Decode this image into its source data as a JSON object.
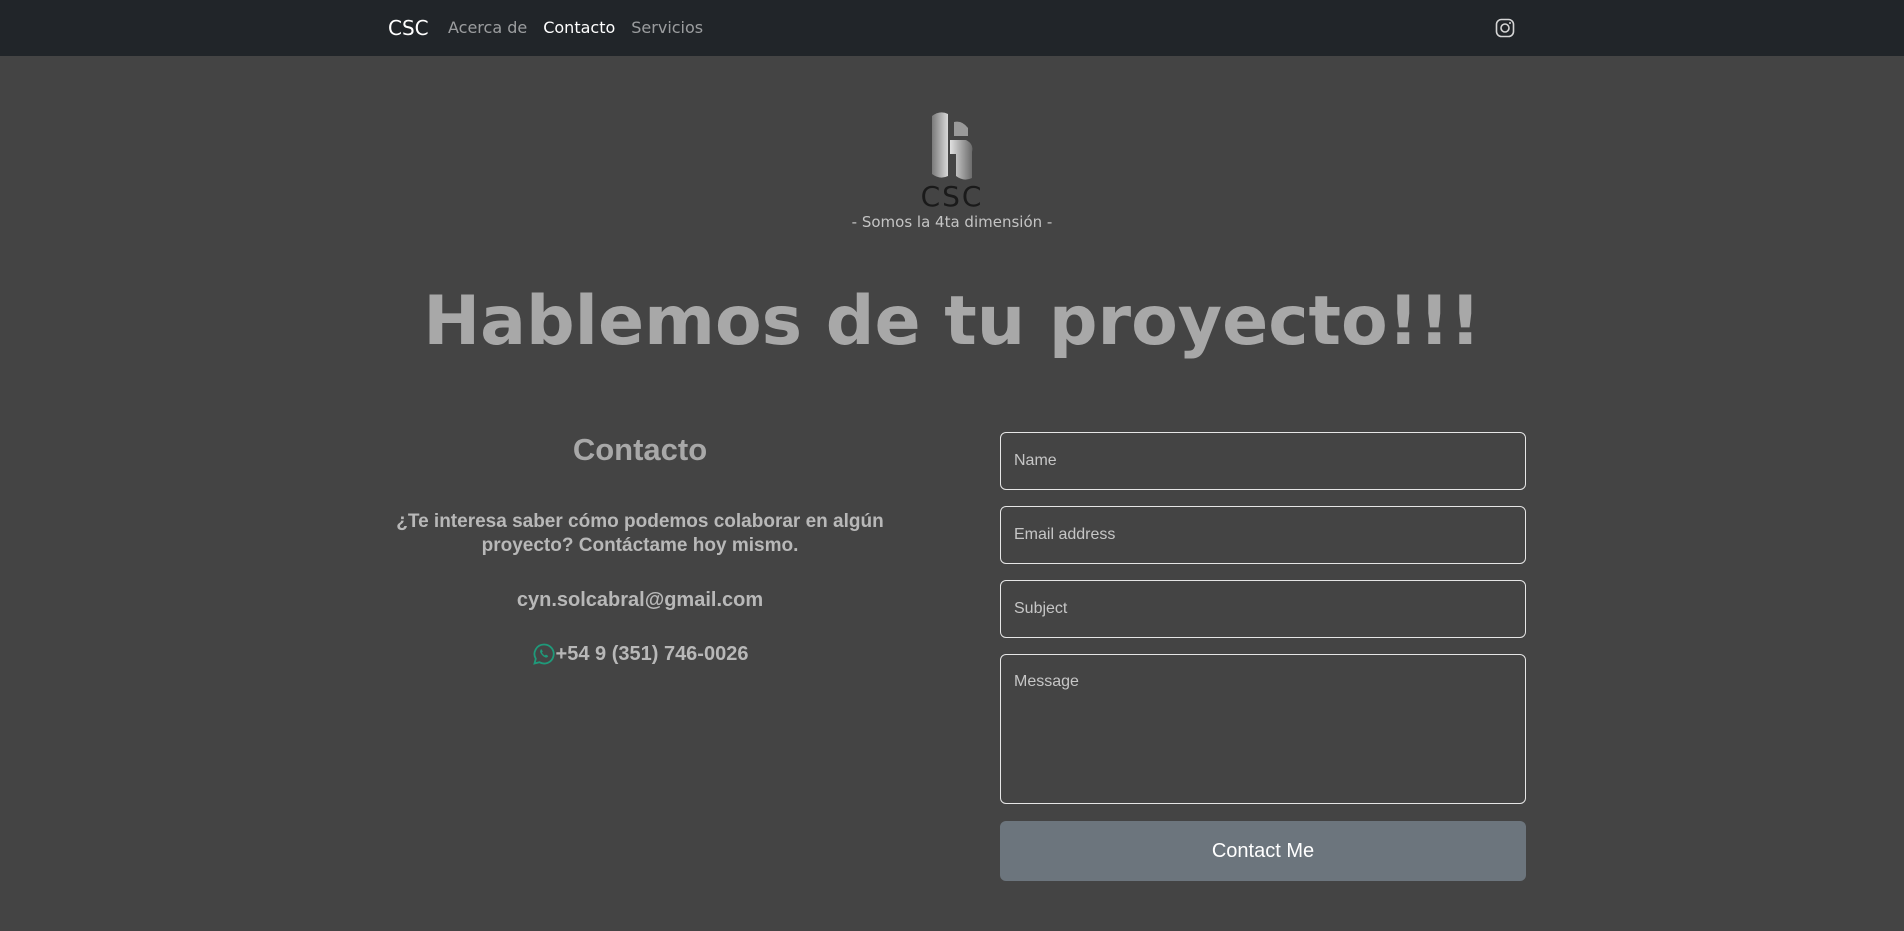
{
  "navbar": {
    "brand": "CSC",
    "links": [
      {
        "label": "Acerca de",
        "active": false
      },
      {
        "label": "Contacto",
        "active": true
      },
      {
        "label": "Servicios",
        "active": false
      }
    ],
    "social_icon": "instagram-icon"
  },
  "header": {
    "logo_text": "CSC",
    "tagline": "- Somos la 4ta dimensión -",
    "hero_title": "Hablemos de tu proyecto!!!"
  },
  "contact_info": {
    "title": "Contacto",
    "pitch": "¿Te interesa saber cómo podemos colaborar en algún proyecto? Contáctame hoy mismo.",
    "email": "cyn.solcabral@gmail.com",
    "phone_icon": "whatsapp-icon",
    "phone": "+54 9 (351) 746-0026"
  },
  "form": {
    "name_placeholder": "Name",
    "email_placeholder": "Email address",
    "subject_placeholder": "Subject",
    "message_placeholder": "Message",
    "submit_label": "Contact Me"
  },
  "colors": {
    "navbar_bg": "#212529",
    "page_bg": "#444444",
    "button_bg": "#6c757d",
    "whatsapp_green": "#1f9a7a"
  }
}
